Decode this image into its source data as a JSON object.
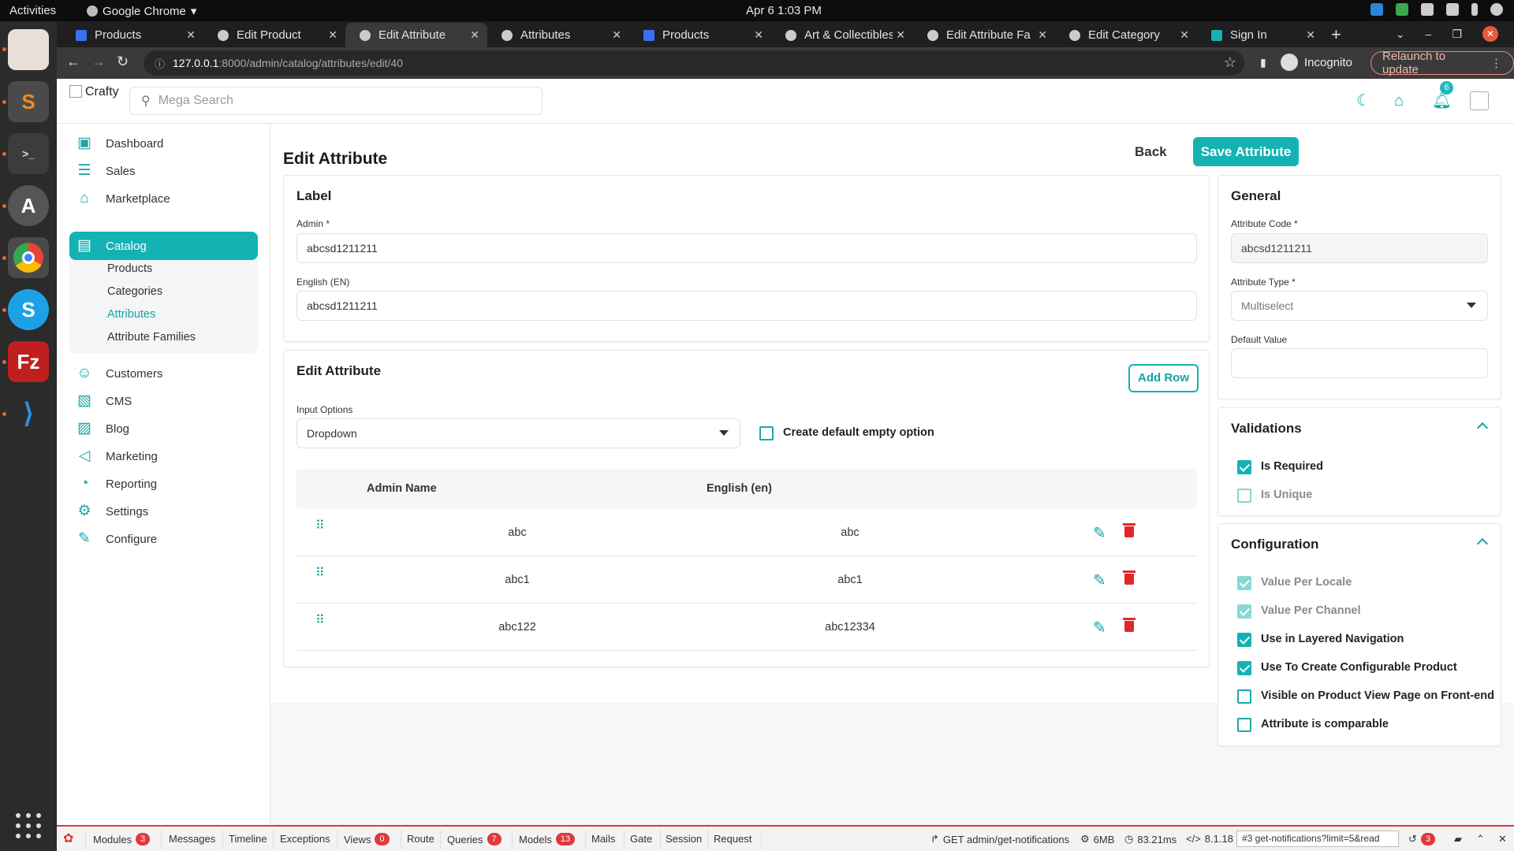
{
  "system": {
    "activities": "Activities",
    "app_name": "Google Chrome",
    "clock": "Apr 6  1:03 PM"
  },
  "tabs": [
    {
      "title": "Products"
    },
    {
      "title": "Edit Product"
    },
    {
      "title": "Edit Attribute"
    },
    {
      "title": "Attributes"
    },
    {
      "title": "Products"
    },
    {
      "title": "Art & Collectibles"
    },
    {
      "title": "Edit Attribute Fa"
    },
    {
      "title": "Edit Category"
    },
    {
      "title": "Sign In"
    }
  ],
  "browser": {
    "url_host": "127.0.0.1",
    "url_path": ":8000/admin/catalog/attributes/edit/40",
    "incognito": "Incognito",
    "relaunch": "Relaunch to update"
  },
  "header": {
    "logo_alt": "Crafty",
    "search_placeholder": "Mega Search",
    "notifications_count": "6"
  },
  "sidebar": {
    "items": [
      {
        "label": "Dashboard",
        "icon": "dashboard-icon"
      },
      {
        "label": "Sales",
        "icon": "sales-icon"
      },
      {
        "label": "Marketplace",
        "icon": "marketplace-icon"
      },
      {
        "label": "Catalog",
        "icon": "catalog-icon"
      },
      {
        "label": "Customers",
        "icon": "customers-icon"
      },
      {
        "label": "CMS",
        "icon": "cms-icon"
      },
      {
        "label": "Blog",
        "icon": "blog-icon"
      },
      {
        "label": "Marketing",
        "icon": "marketing-icon"
      },
      {
        "label": "Reporting",
        "icon": "reporting-icon"
      },
      {
        "label": "Settings",
        "icon": "settings-icon"
      },
      {
        "label": "Configure",
        "icon": "configure-icon"
      }
    ],
    "catalog_sub": [
      {
        "label": "Products"
      },
      {
        "label": "Categories"
      },
      {
        "label": "Attributes"
      },
      {
        "label": "Attribute Families"
      }
    ]
  },
  "page": {
    "title": "Edit Attribute",
    "back": "Back",
    "save": "Save Attribute"
  },
  "label_card": {
    "title": "Label",
    "admin_label": "Admin *",
    "admin_value": "abcsd1211211",
    "english_label": "English (EN)",
    "english_value": "abcsd1211211"
  },
  "options_card": {
    "title": "Edit Attribute",
    "add_row": "Add Row",
    "input_options_label": "Input Options",
    "input_options_value": "Dropdown",
    "default_empty_label": "Create default empty option",
    "columns": [
      "Admin Name",
      "English (en)"
    ],
    "rows": [
      {
        "admin": "abc",
        "english": "abc"
      },
      {
        "admin": "abc1",
        "english": "abc1"
      },
      {
        "admin": "abc122",
        "english": "abc12334"
      }
    ]
  },
  "general_card": {
    "title": "General",
    "code_label": "Attribute Code *",
    "code_value": "abcsd1211211",
    "type_label": "Attribute Type *",
    "type_value": "Multiselect",
    "default_label": "Default Value",
    "default_value": ""
  },
  "validations_card": {
    "title": "Validations",
    "items": [
      {
        "label": "Is Required",
        "checked": true
      },
      {
        "label": "Is Unique",
        "checked": false
      }
    ]
  },
  "configuration_card": {
    "title": "Configuration",
    "items": [
      {
        "label": "Value Per Locale",
        "checked": true
      },
      {
        "label": "Value Per Channel",
        "checked": true
      },
      {
        "label": "Use in Layered Navigation",
        "checked": true
      },
      {
        "label": "Use To Create Configurable Product",
        "checked": true
      },
      {
        "label": "Visible on Product View Page on Front-end",
        "checked": false
      },
      {
        "label": "Attribute is comparable",
        "checked": false
      }
    ]
  },
  "debugbar": {
    "modules": "Modules",
    "modules_count": "3",
    "messages": "Messages",
    "timeline": "Timeline",
    "exceptions": "Exceptions",
    "views": "Views",
    "views_count": "0",
    "route": "Route",
    "queries": "Queries",
    "queries_count": "7",
    "models": "Models",
    "models_count": "13",
    "mails": "Mails",
    "gate": "Gate",
    "session": "Session",
    "request": "Request",
    "request_info": "GET admin/get-notifications",
    "memory": "6MB",
    "duration": "83.21ms",
    "php": "8.1.18",
    "select": "#3 get-notifications?limit=5&read",
    "history_count": "3"
  }
}
